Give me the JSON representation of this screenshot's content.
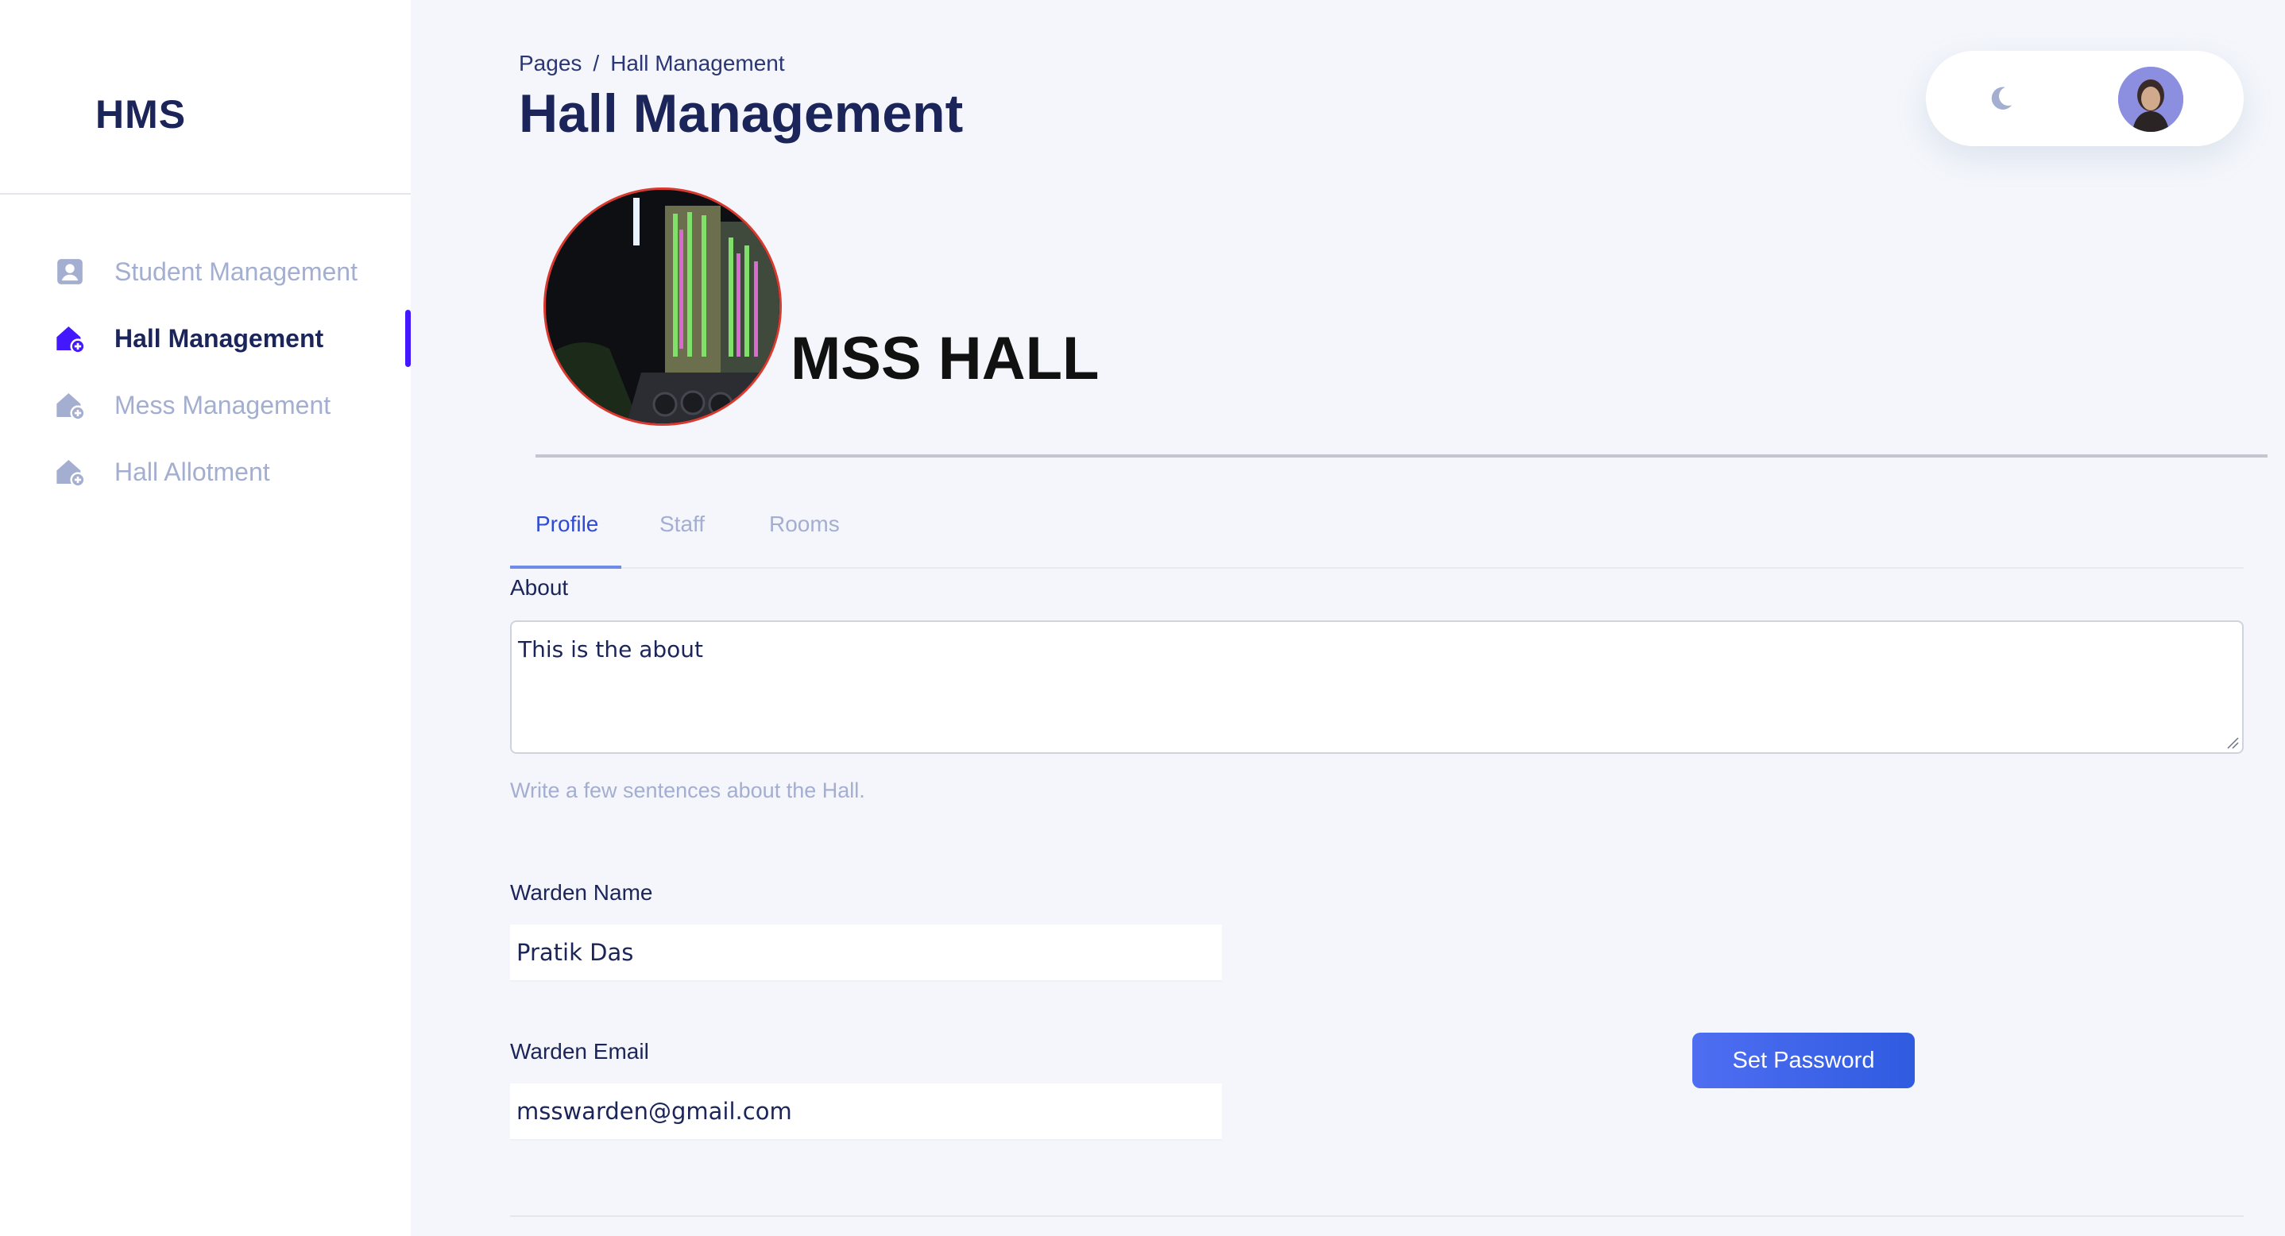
{
  "app": {
    "logo": "HMS"
  },
  "sidebar": {
    "items": [
      {
        "label": "Student Management",
        "icon": "person-badge-icon",
        "active": false
      },
      {
        "label": "Hall Management",
        "icon": "home-plus-icon",
        "active": true
      },
      {
        "label": "Mess Management",
        "icon": "home-plus-icon",
        "active": false
      },
      {
        "label": "Hall Allotment",
        "icon": "home-plus-icon",
        "active": false
      }
    ]
  },
  "header": {
    "breadcrumb": {
      "root": "Pages",
      "separator": "/",
      "current": "Hall Management"
    },
    "title": "Hall Management"
  },
  "hall": {
    "name": "MSS HALL",
    "photo": "hall-photo-at-night"
  },
  "tabs": [
    {
      "label": "Profile",
      "active": true
    },
    {
      "label": "Staff",
      "active": false
    },
    {
      "label": "Rooms",
      "active": false
    }
  ],
  "profile": {
    "about_label": "About",
    "about_value": "This is the about",
    "about_helper": "Write a few sentences about the Hall.",
    "warden_name_label": "Warden Name",
    "warden_name_value": "Pratik Das",
    "warden_email_label": "Warden Email",
    "warden_email_value": "msswarden@gmail.com",
    "set_password_label": "Set Password"
  },
  "colors": {
    "accent": "#4318ff",
    "primary_text": "#1b2559",
    "muted_text": "#a3aed0",
    "button": "#3b5de7",
    "background": "#f4f6fb"
  }
}
